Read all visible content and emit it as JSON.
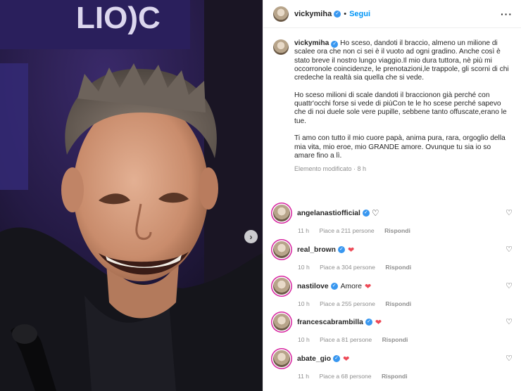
{
  "post": {
    "username": "vickymiha",
    "follow_label": "Segui",
    "more_icon": "more-horizontal-icon"
  },
  "caption": {
    "username": "vickymiha",
    "paragraphs": [
      "Ho sceso, dandoti il braccio, almeno un milione di scalee ora che non ci sei è il vuoto ad ogni gradino. Anche così è stato breve il nostro lungo viaggio.Il mio dura tuttora, nè più mi occorronole coincidenze, le prenotazioni,le trappole, gli scorni di chi credeche la realtà sia quella che si vede.",
      "Ho sceso milioni di scale dandoti il braccionon già perché con quattr'occhi forse si vede di piùCon te le ho scese perché sapevo che di noi duele sole vere pupille, sebbene tanto offuscate,erano le tue.",
      "Ti amo con tutto il mio cuore papà, anima pura, rara, orgoglio della mia vita, mio eroe, mio GRANDE amore. Ovunque tu sia io so amare fino a lì."
    ],
    "edited": "Elemento modificato · 8 h"
  },
  "comments": [
    {
      "username": "angelanastiofficial",
      "text": "",
      "heart": "outline",
      "time": "11 h",
      "likes": "Piace a 211 persone",
      "reply": "Rispondi"
    },
    {
      "username": "real_brown",
      "text": "",
      "heart": "red",
      "time": "10 h",
      "likes": "Piace a 304 persone",
      "reply": "Rispondi"
    },
    {
      "username": "nastilove",
      "text": "Amore",
      "heart": "red",
      "time": "10 h",
      "likes": "Piace a 255 persone",
      "reply": "Rispondi"
    },
    {
      "username": "francescabrambilla",
      "text": "",
      "heart": "red",
      "time": "10 h",
      "likes": "Piace a 81 persone",
      "reply": "Rispondi"
    },
    {
      "username": "abate_gio",
      "text": "",
      "heart": "red",
      "time": "11 h",
      "likes": "Piace a 68 persone",
      "reply": "Rispondi"
    }
  ],
  "colors": {
    "accent": "#0095f6",
    "heart_red": "#ed4956",
    "muted": "#8e8e8e"
  }
}
